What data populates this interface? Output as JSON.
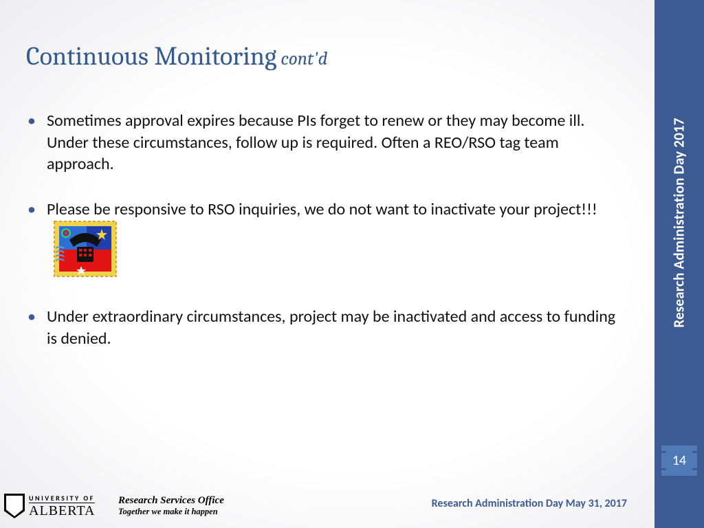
{
  "title": {
    "main": "Continuous Monitoring",
    "suffix": " cont'd"
  },
  "bullets": [
    "Sometimes approval expires because PIs forget to renew or they may become ill. Under these circumstances, follow up is required. Often a REO/RSO tag team approach.",
    "Please be responsive to RSO inquiries, we do not want to inactivate your project!!!",
    "Under extraordinary circumstances, project may be inactivated and access to funding is denied."
  ],
  "sidebar": {
    "label": "Research Administration Day 2017"
  },
  "page_number": "14",
  "logo": {
    "line1": "UNIVERSITY OF",
    "line2": "ALBERTA"
  },
  "office": {
    "line1": "Research Services Office",
    "line2": "Together we make it happen"
  },
  "footer_right": "Research Administration Day May 31, 2017",
  "colors": {
    "accent": "#3b5b92",
    "page_box": "#507ab5"
  }
}
